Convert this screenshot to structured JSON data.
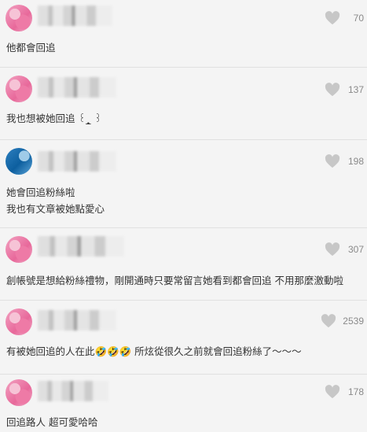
{
  "comments": [
    {
      "avatar_style": "pink",
      "likes": "70",
      "lines": [
        "他都會回追"
      ]
    },
    {
      "avatar_style": "pink",
      "likes": "137",
      "lines": [
        "我也想被她回追 ꒰_̩̩̥ ꒱"
      ]
    },
    {
      "avatar_style": "blue",
      "likes": "198",
      "lines": [
        "她會回追粉絲啦",
        "我也有文章被她點愛心"
      ]
    },
    {
      "avatar_style": "pink",
      "likes": "307",
      "lines": [
        "創帳號是想給粉絲禮物，剛開通時只要常留言她看到都會回追 不用那麼激動啦"
      ]
    },
    {
      "avatar_style": "pink",
      "likes": "2539",
      "lines": [
        "有被她回追的人在此🤣🤣🤣 所炫從很久之前就會回追粉絲了～～～"
      ]
    },
    {
      "avatar_style": "pink",
      "likes": "178",
      "lines": [
        "回追路人 超可愛哈哈"
      ]
    }
  ],
  "icons": {
    "like": "heart-outline-icon"
  },
  "colors": {
    "heart": "#c7c7c7",
    "background": "#f4f4f4",
    "divider": "#e0e0e0"
  }
}
